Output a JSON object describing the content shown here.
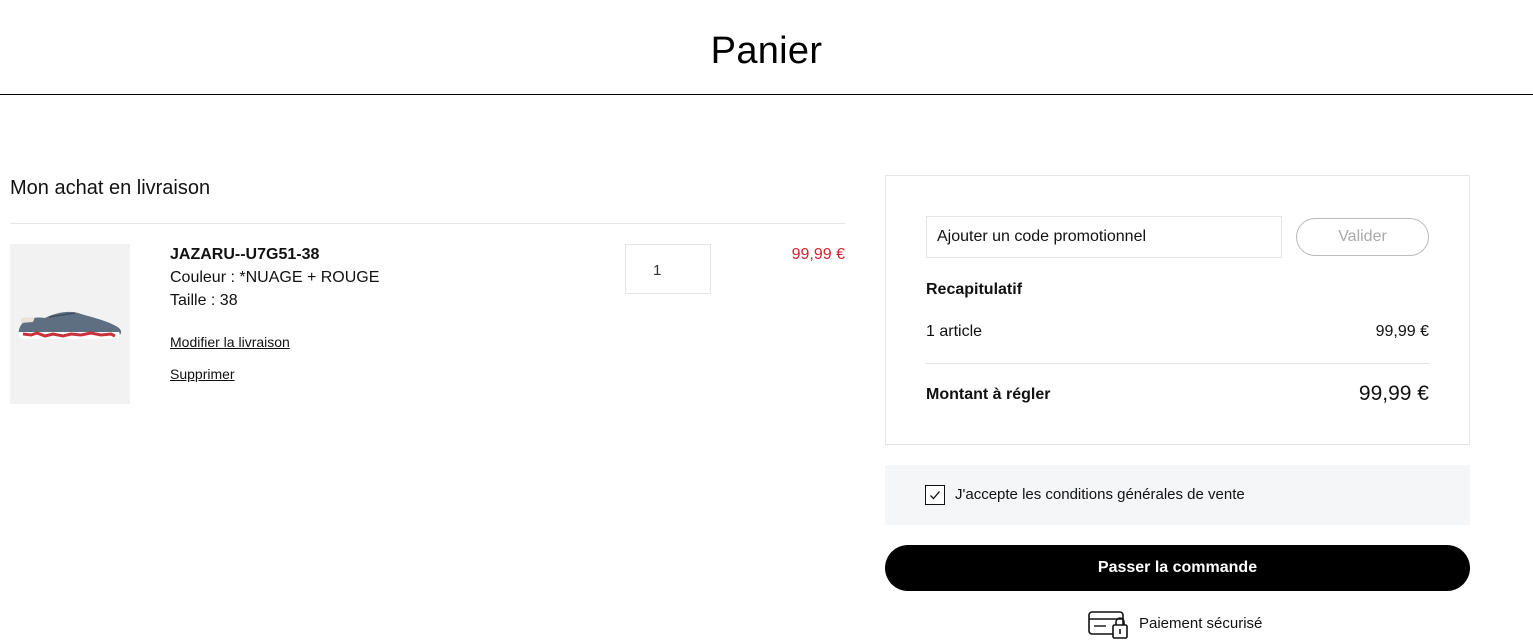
{
  "header": {
    "title": "Panier"
  },
  "cart": {
    "section_title": "Mon achat en livraison",
    "item": {
      "reference": "JAZARU--U7G51-38",
      "color": "Couleur : *NUAGE + ROUGE",
      "size": "Taille : 38",
      "modify_link": "Modifier la livraison",
      "delete_link": "Supprimer",
      "quantity": "1",
      "price": "99,99 €",
      "image_icon": "shoe-image"
    }
  },
  "summary": {
    "promo_placeholder": "Ajouter un code promotionnel",
    "validate_label": "Valider",
    "recap_title": "Recapitulatif",
    "article_count": "1 article",
    "article_price": "99,99 €",
    "total_label": "Montant à régler",
    "total_value": "99,99 €"
  },
  "terms": {
    "label": "J'accepte les conditions générales de vente",
    "checked": true
  },
  "order": {
    "button_label": "Passer la commande"
  },
  "secure": {
    "label": "Paiement sécurisé",
    "icon": "secure-card-lock-icon"
  },
  "colors": {
    "price_red": "#d6212e",
    "button_black": "#000000",
    "terms_bg": "#f5f6f7"
  }
}
